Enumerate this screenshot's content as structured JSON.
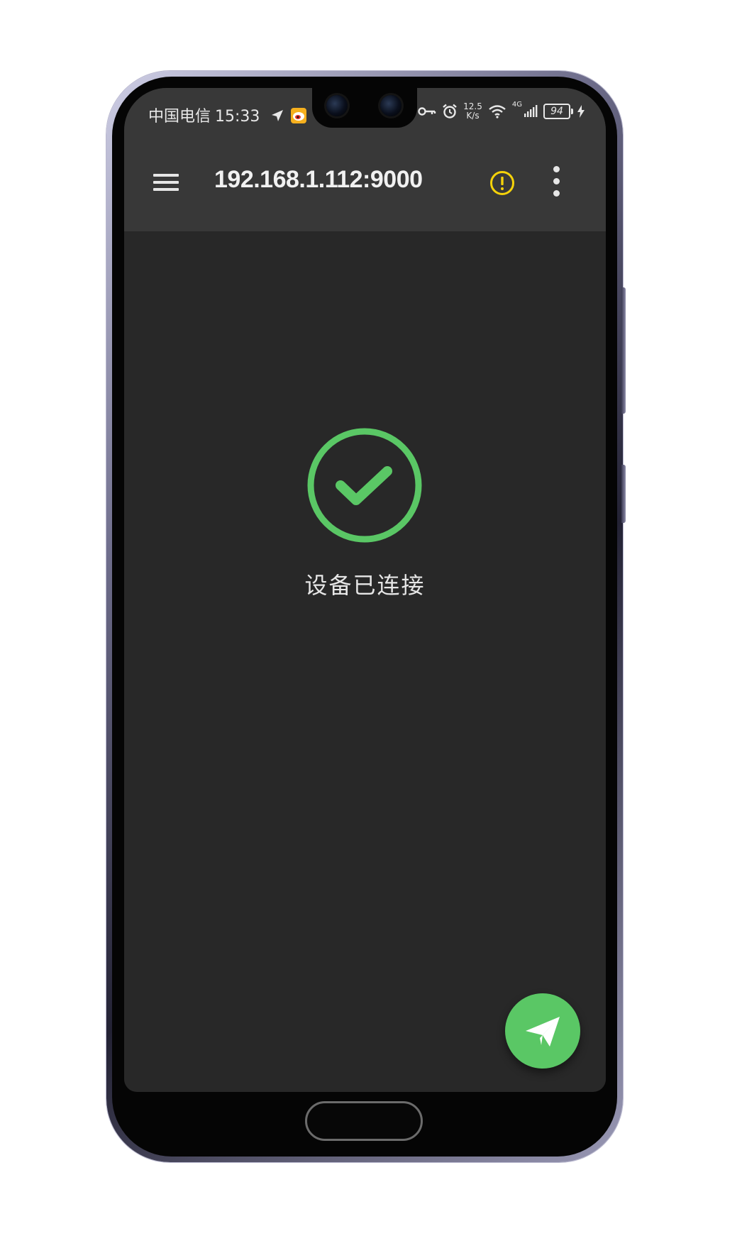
{
  "status_bar": {
    "carrier": "中国电信",
    "time": "15:33",
    "net_speed_value": "12.5",
    "net_speed_unit": "K/s",
    "network_type": "4G",
    "battery_level": "94"
  },
  "app_bar": {
    "title": "192.168.1.112:9000"
  },
  "main": {
    "status_message": "设备已连接"
  },
  "colors": {
    "app_bar_bg": "#383838",
    "screen_bg": "#282828",
    "success_green": "#5ac765",
    "warning_yellow": "#f5d20a"
  },
  "icons": {
    "menu": "hamburger-menu-icon",
    "warning": "warning-circle-icon",
    "more": "more-vertical-icon",
    "connected": "check-circle-icon",
    "send": "paper-plane-icon"
  }
}
